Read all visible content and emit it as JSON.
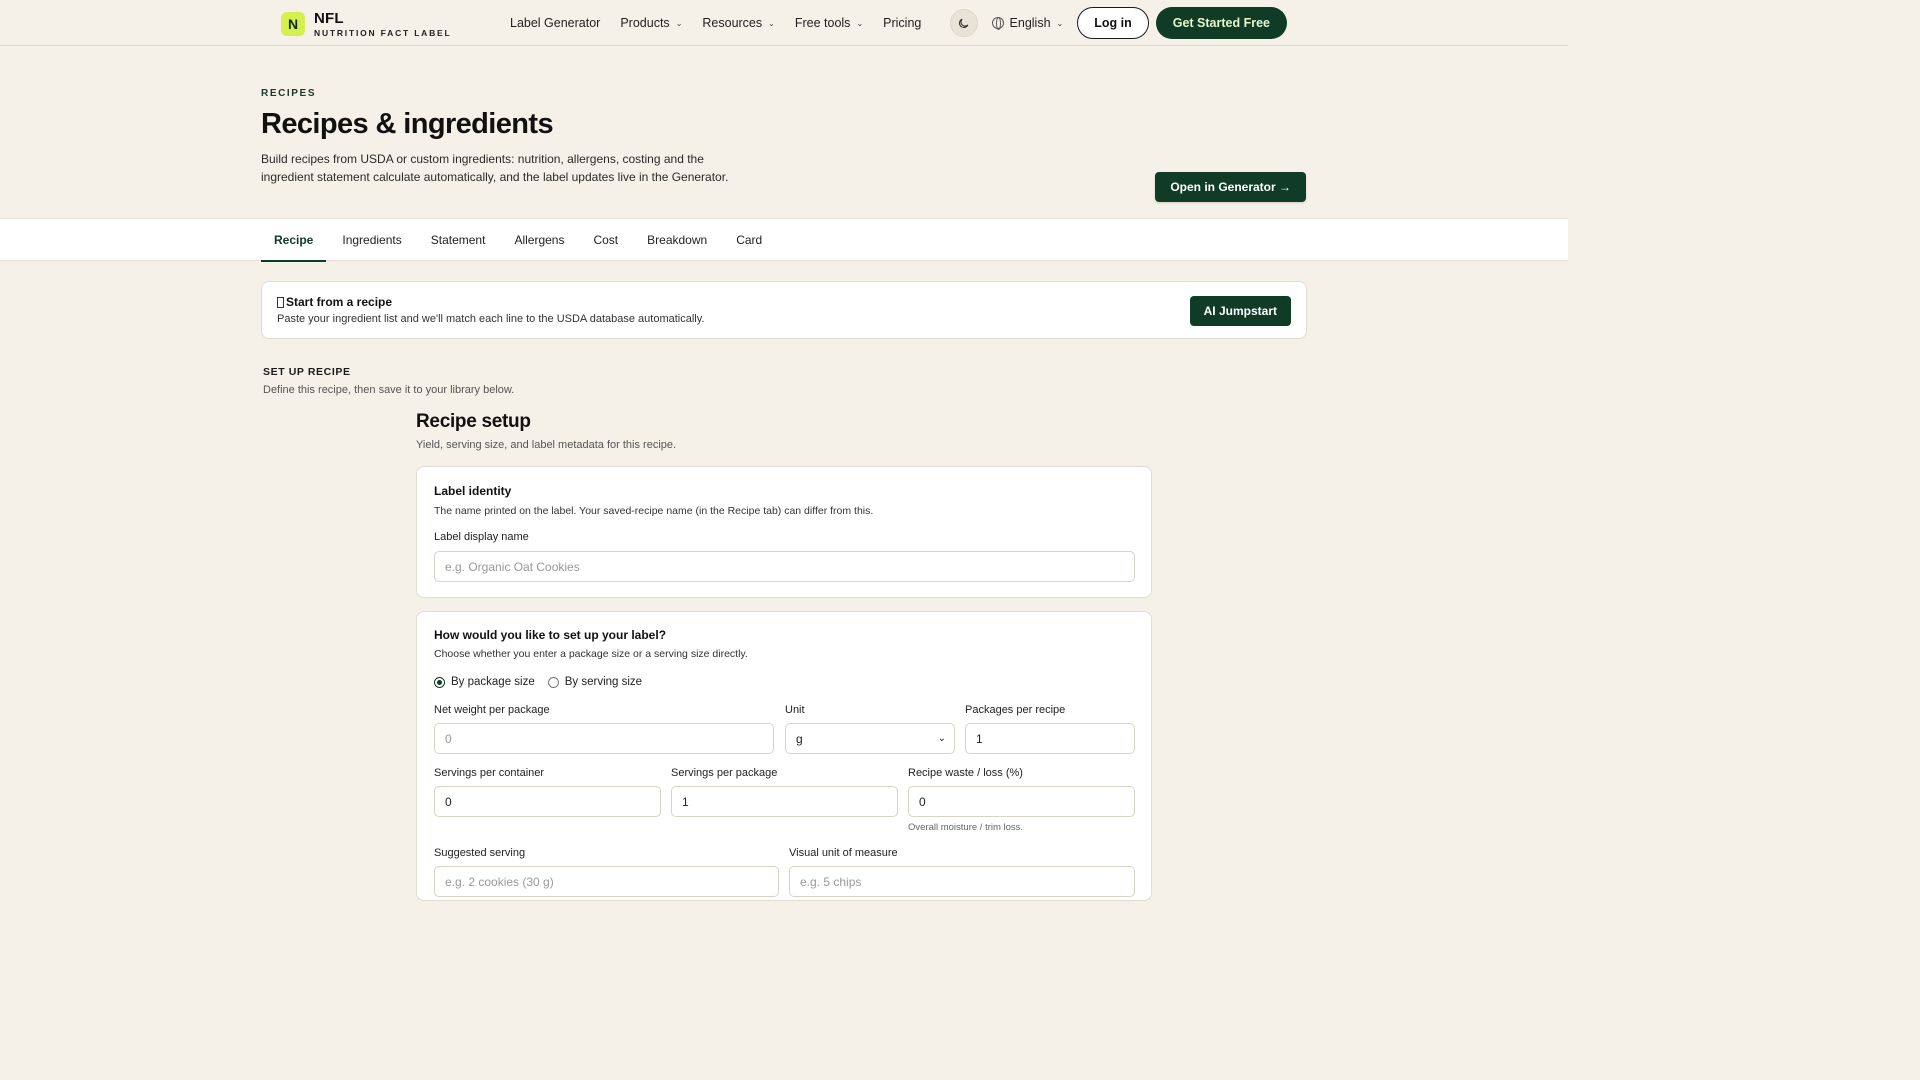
{
  "brand": {
    "mark": "N",
    "name": "NFL",
    "subtitle": "NUTRITION FACT LABEL"
  },
  "nav": {
    "links": [
      {
        "label": "Label Generator",
        "dropdown": false
      },
      {
        "label": "Products",
        "dropdown": true
      },
      {
        "label": "Resources",
        "dropdown": true
      },
      {
        "label": "Free tools",
        "dropdown": true
      },
      {
        "label": "Pricing",
        "dropdown": false
      }
    ],
    "theme_icon": "moon-icon",
    "language": "English",
    "login": "Log in",
    "cta": "Get Started Free"
  },
  "hero": {
    "eyebrow": "RECIPES",
    "title": "Recipes & ingredients",
    "description": "Build recipes from USDA or custom ingredients: nutrition, allergens, costing and the ingredient statement calculate automatically, and the label updates live in the Generator.",
    "open_button": "Open in Generator →"
  },
  "tabs": [
    "Recipe",
    "Ingredients",
    "Statement",
    "Allergens",
    "Cost",
    "Breakdown",
    "Card"
  ],
  "active_tab": "Recipe",
  "jumpstart": {
    "title": "Start from a recipe",
    "description": "Paste your ingredient list and we'll match each line to the USDA database automatically.",
    "button": "AI Jumpstart"
  },
  "setup": {
    "label": "SET UP RECIPE",
    "subtitle": "Define this recipe, then save it to your library below."
  },
  "recipe_setup": {
    "title": "Recipe setup",
    "subtitle": "Yield, serving size, and label metadata for this recipe."
  },
  "identity": {
    "title": "Label identity",
    "description": "The name printed on the label. Your saved-recipe name (in the Recipe tab) can differ from this.",
    "field_label": "Label display name",
    "placeholder": "e.g. Organic Oat Cookies"
  },
  "setup_mode": {
    "title": "How would you like to set up your label?",
    "description": "Choose whether you enter a package size or a serving size directly.",
    "options": [
      "By package size",
      "By serving size"
    ],
    "selected": "By package size",
    "net_weight": {
      "label": "Net weight per package",
      "placeholder": "0"
    },
    "unit": {
      "label": "Unit",
      "value": "g"
    },
    "packages_per_recipe": {
      "label": "Packages per recipe",
      "value": "1"
    },
    "servings_per_container": {
      "label": "Servings per container",
      "value": "0"
    },
    "servings_per_package": {
      "label": "Servings per package",
      "value": "1"
    },
    "waste": {
      "label": "Recipe waste / loss (%)",
      "value": "0",
      "help": "Overall moisture / trim loss."
    },
    "suggested_serving": {
      "label": "Suggested serving",
      "placeholder": "e.g. 2 cookies (30 g)"
    },
    "visual_unit": {
      "label": "Visual unit of measure",
      "placeholder": "e.g. 5 chips"
    }
  }
}
